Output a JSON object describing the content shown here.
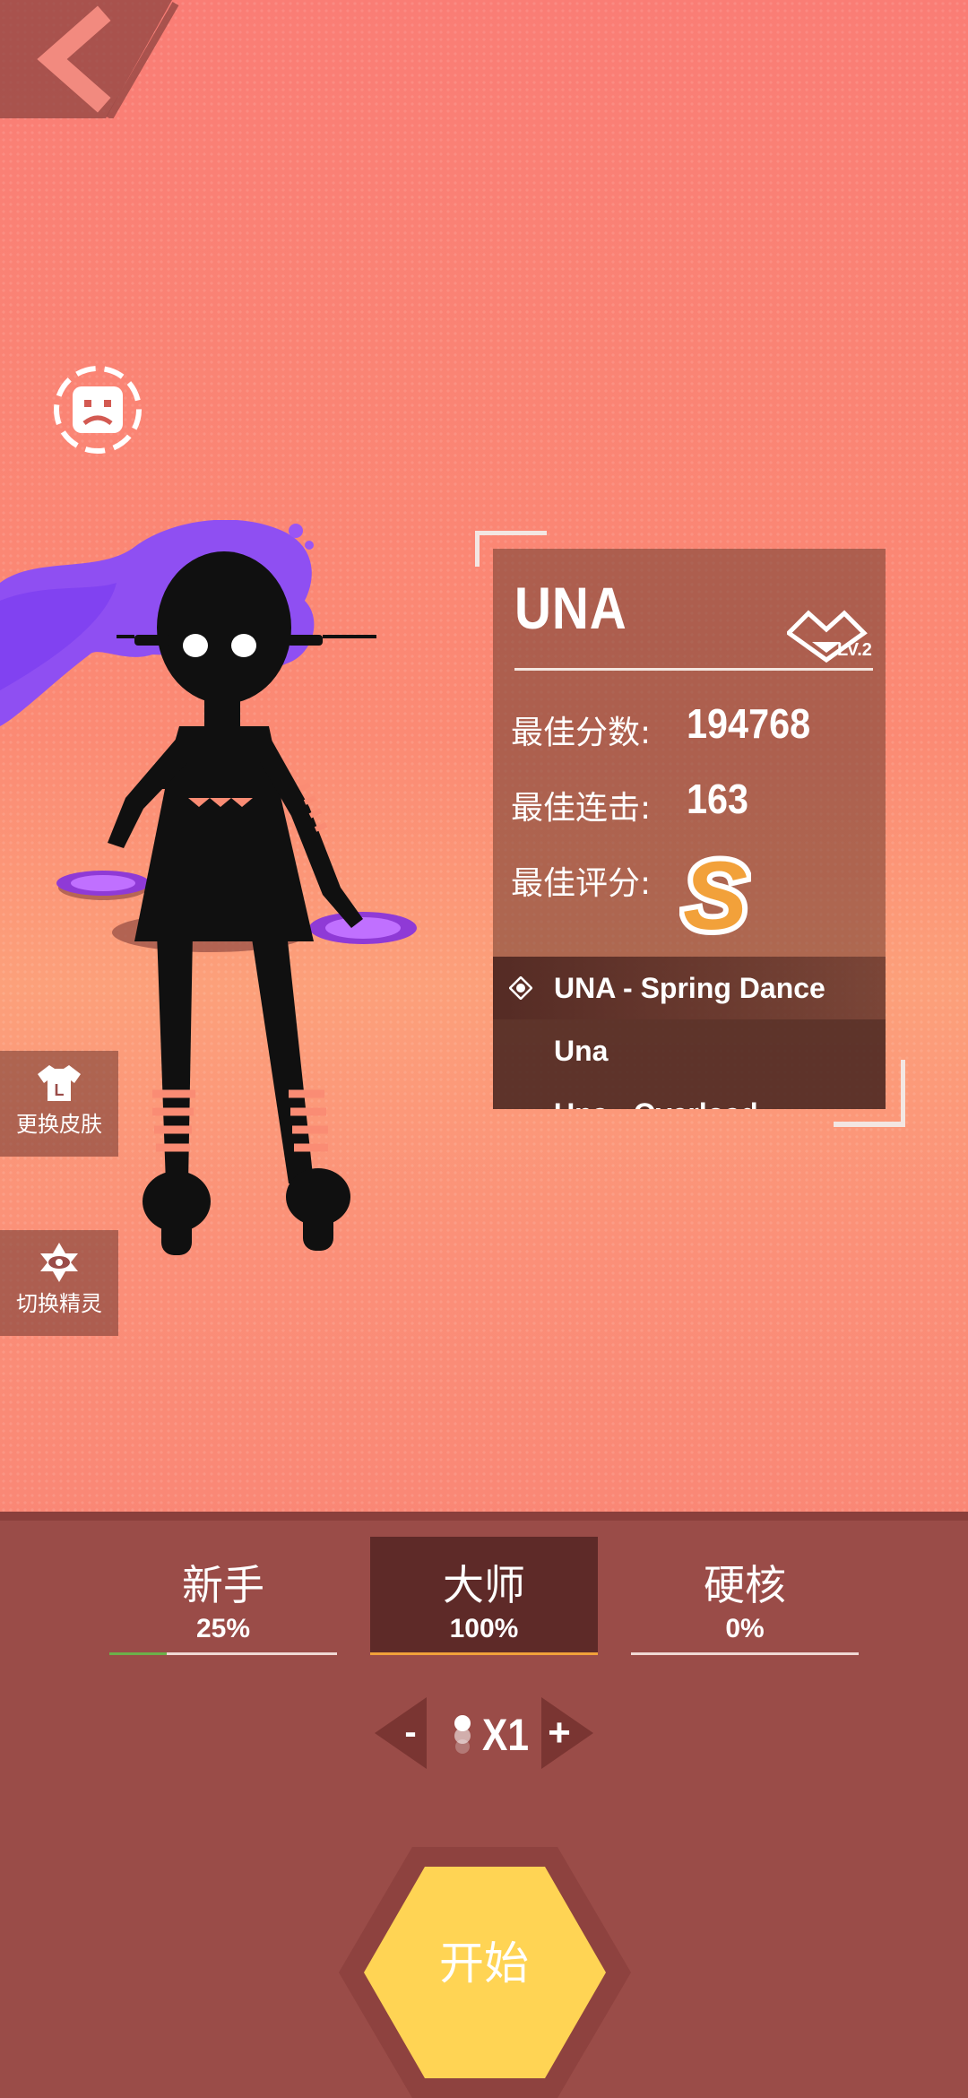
{
  "character": {
    "name": "UNA",
    "level": "LV.2",
    "stats": [
      {
        "label": "最佳分数:",
        "value": "194768"
      },
      {
        "label": "最佳连击:",
        "value": "163"
      },
      {
        "label": "最佳评分:",
        "value": ""
      }
    ],
    "rank": "S"
  },
  "songs": [
    {
      "title": "UNA - Spring Dance",
      "selected": true
    },
    {
      "title": "Una",
      "selected": false
    },
    {
      "title": "Una - Overload",
      "selected": false
    }
  ],
  "side_buttons": {
    "change_skin": "更换皮肤",
    "switch_sprite": "切换精灵"
  },
  "difficulties": [
    {
      "name": "新手",
      "percent": "25%",
      "progress": 0.25,
      "active": false
    },
    {
      "name": "大师",
      "percent": "100%",
      "progress": 1.0,
      "active": true
    },
    {
      "name": "硬核",
      "percent": "0%",
      "progress": 0.0,
      "active": false
    }
  ],
  "speed": {
    "label": "X1",
    "minus": "-",
    "plus": "+"
  },
  "start_button": "开始",
  "colors": {
    "accent_green": "#6cb04a",
    "accent_orange": "#f2a13a",
    "start_yellow": "#ffd454",
    "purple_hair": "#9a55f5"
  }
}
